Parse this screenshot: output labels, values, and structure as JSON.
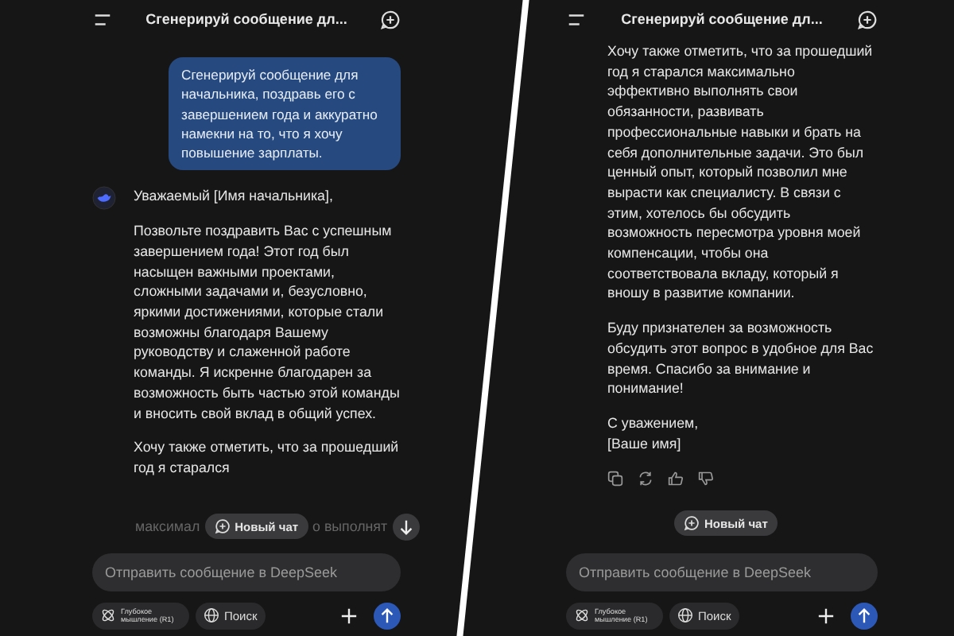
{
  "screens": [
    {
      "header": {
        "title": "Сгенерируй сообщение дл..."
      },
      "messages": [
        {
          "kind": "user",
          "paragraphs": [
            "Сгенерируй сообщение для начальника, поздравь его с завершением года и аккуратно намекни на то, что я хочу повышение зарплаты."
          ]
        },
        {
          "kind": "assistant",
          "avatar": true,
          "actions": false,
          "paragraphs": [
            "Уважаемый [Имя начальника],",
            "Позвольте поздравить Вас с успешным завершением года! Этот год был насыщен важными проектами, сложными задачами и, безусловно, яркими достижениями, которые стали возможны благодаря Вашему руководству и слаженной работе команды. Я искренне благодарен за возможность быть частью этой команды и вносить свой вклад в общий успех.",
            "Хочу также отметить, что за прошедший год я старался"
          ]
        }
      ],
      "faded_line": {
        "before": "максимал",
        "after": "о выполнят"
      },
      "scroll_down": true,
      "new_chat": "Новый чат",
      "input": {
        "placeholder": "Отправить сообщение в DeepSeek"
      },
      "toggles": [
        {
          "kind": "deep",
          "label": "Глубокое мышление (R1)"
        },
        {
          "kind": "search",
          "label": "Поиск"
        }
      ]
    },
    {
      "header": {
        "title": "Сгенерируй сообщение дл..."
      },
      "messages": [
        {
          "kind": "assistant",
          "avatar": false,
          "actions": true,
          "paragraphs": [
            "Хочу также отметить, что за прошедший год я старался максимально эффективно выполнять свои обязанности, развивать профессиональные навыки и брать на себя дополнительные задачи. Это был ценный опыт, который позволил мне вырасти как специалисту. В связи с этим, хотелось бы обсудить возможность пересмотра уровня моей компенсации, чтобы она соответствовала вкладу, который я вношу в развитие компании.",
            "Буду признателен за возможность обсудить этот вопрос в удобное для Вас время. Спасибо за внимание и понимание!",
            "С уважением,\n[Ваше имя]"
          ]
        }
      ],
      "scroll_down": false,
      "new_chat": "Новый чат",
      "input": {
        "placeholder": "Отправить сообщение в DeepSeek"
      },
      "toggles": [
        {
          "kind": "deep",
          "label": "Глубокое мышление (R1)"
        },
        {
          "kind": "search",
          "label": "Поиск"
        }
      ]
    }
  ]
}
